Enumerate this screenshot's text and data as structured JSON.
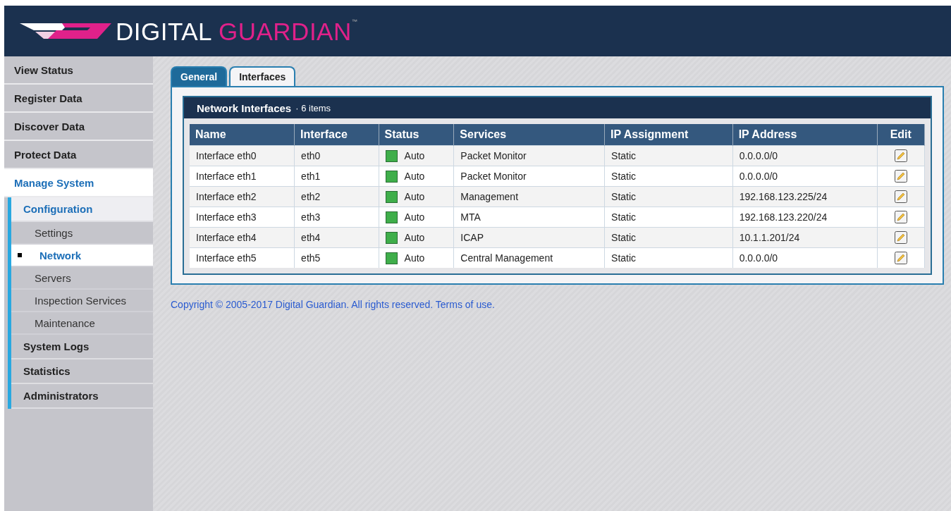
{
  "header": {
    "logo_words": [
      "DIGITAL",
      "GUARDIAN"
    ],
    "trademark": "™"
  },
  "sidebar": {
    "items": [
      {
        "label": "View Status",
        "selected": false
      },
      {
        "label": "Register Data",
        "selected": false
      },
      {
        "label": "Discover Data",
        "selected": false
      },
      {
        "label": "Protect Data",
        "selected": false
      },
      {
        "label": "Manage System",
        "selected": true,
        "children": [
          {
            "label": "Configuration",
            "selected": true,
            "children": [
              {
                "label": "Settings",
                "selected": false
              },
              {
                "label": "Network",
                "selected": true
              },
              {
                "label": "Servers",
                "selected": false
              },
              {
                "label": "Inspection Services",
                "selected": false
              },
              {
                "label": "Maintenance",
                "selected": false
              }
            ]
          },
          {
            "label": "System Logs",
            "selected": false
          },
          {
            "label": "Statistics",
            "selected": false
          },
          {
            "label": "Administrators",
            "selected": false
          }
        ]
      }
    ]
  },
  "tabs": [
    {
      "label": "General",
      "selected": false
    },
    {
      "label": "Interfaces",
      "selected": true
    }
  ],
  "panel": {
    "title": "Network Interfaces",
    "count": "· 6 items"
  },
  "table": {
    "columns": [
      "Name",
      "Interface",
      "Status",
      "Services",
      "IP Assignment",
      "IP Address",
      "Edit"
    ],
    "rows": [
      {
        "name": "Interface eth0",
        "interface": "eth0",
        "status": "Auto",
        "services": "Packet Monitor",
        "ip_assignment": "Static",
        "ip_address": "0.0.0.0/0"
      },
      {
        "name": "Interface eth1",
        "interface": "eth1",
        "status": "Auto",
        "services": "Packet Monitor",
        "ip_assignment": "Static",
        "ip_address": "0.0.0.0/0"
      },
      {
        "name": "Interface eth2",
        "interface": "eth2",
        "status": "Auto",
        "services": "Management",
        "ip_assignment": "Static",
        "ip_address": "192.168.123.225/24"
      },
      {
        "name": "Interface eth3",
        "interface": "eth3",
        "status": "Auto",
        "services": "MTA",
        "ip_assignment": "Static",
        "ip_address": "192.168.123.220/24"
      },
      {
        "name": "Interface eth4",
        "interface": "eth4",
        "status": "Auto",
        "services": "ICAP",
        "ip_assignment": "Static",
        "ip_address": "10.1.1.201/24"
      },
      {
        "name": "Interface eth5",
        "interface": "eth5",
        "status": "Auto",
        "services": "Central Management",
        "ip_assignment": "Static",
        "ip_address": "0.0.0.0/0"
      }
    ]
  },
  "footer": {
    "copyright": "Copyright © 2005-2017 Digital Guardian. All rights reserved.",
    "link": "Terms of use."
  }
}
